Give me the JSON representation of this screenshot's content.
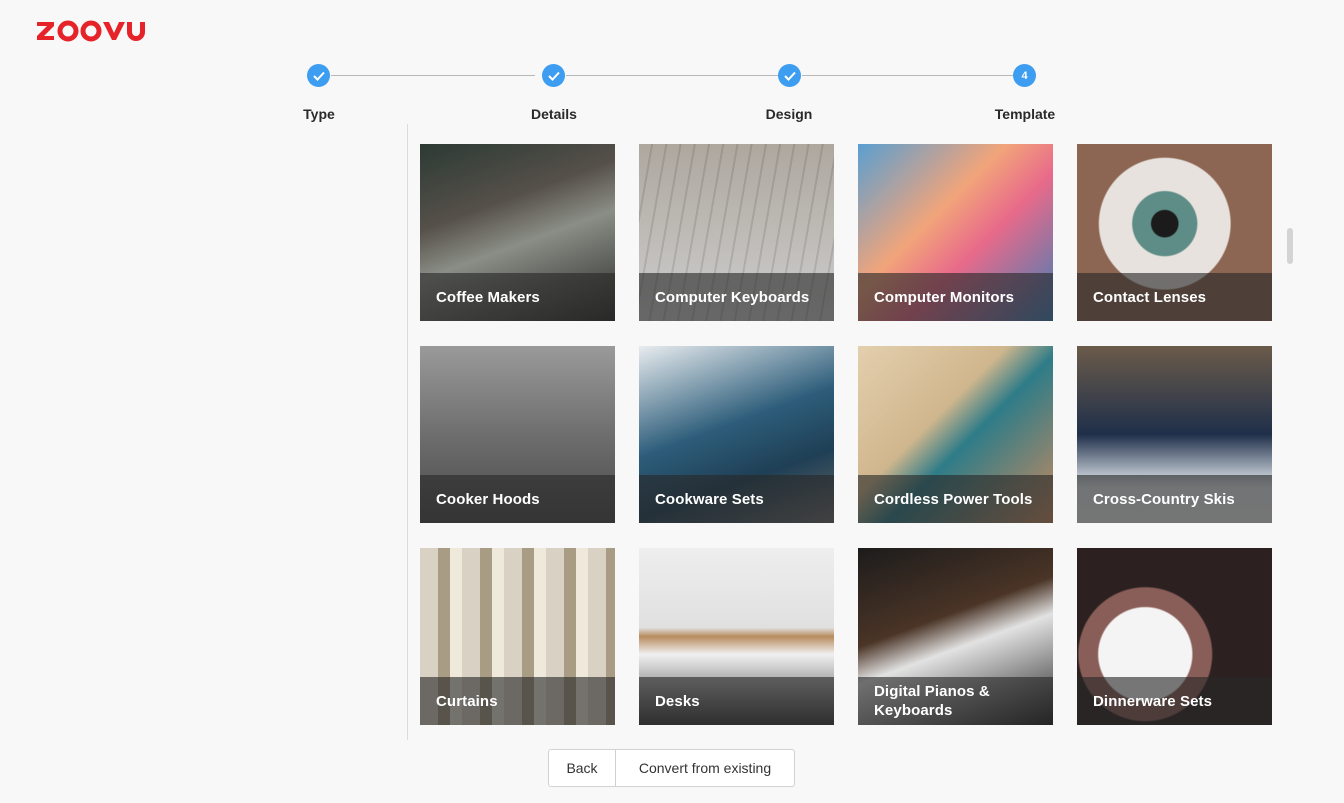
{
  "brand": {
    "logo_text": "ZOOVU",
    "color": "#e52329"
  },
  "stepper": {
    "accent": "#3d9df0",
    "steps": [
      {
        "label": "Type",
        "state": "done",
        "number": ""
      },
      {
        "label": "Details",
        "state": "done",
        "number": ""
      },
      {
        "label": "Design",
        "state": "done",
        "number": ""
      },
      {
        "label": "Template",
        "state": "current",
        "number": "4"
      }
    ]
  },
  "templates": [
    {
      "label": "Coffee Makers"
    },
    {
      "label": "Computer Keyboards"
    },
    {
      "label": "Computer Monitors"
    },
    {
      "label": "Contact Lenses"
    },
    {
      "label": "Cooker Hoods"
    },
    {
      "label": "Cookware Sets"
    },
    {
      "label": "Cordless Power Tools"
    },
    {
      "label": "Cross-Country Skis"
    },
    {
      "label": "Curtains"
    },
    {
      "label": "Desks"
    },
    {
      "label": "Digital Pianos & Keyboards"
    },
    {
      "label": "Dinnerware Sets"
    }
  ],
  "footer": {
    "back_label": "Back",
    "convert_label": "Convert from existing"
  }
}
